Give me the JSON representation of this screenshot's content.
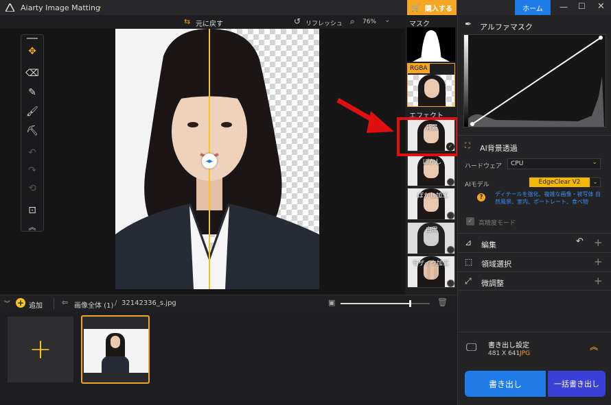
{
  "app": {
    "title": "Aiarty Image Matting",
    "buy_label": "購入する",
    "home_label": "ホーム"
  },
  "toolbar": {
    "undo_all_label": "元に戻す",
    "refresh_label": "リフレッシュ",
    "zoom": "76%"
  },
  "effects": {
    "mask_header": "マスク",
    "rgba_label": "RGBA",
    "effect_header": "エフェクト",
    "items": [
      "背景",
      "ぼかし",
      "ぼかし加工",
      "白黒",
      "モザイク加工"
    ]
  },
  "files": {
    "add_label": "追加",
    "breadcrumb_root": "画像全体 (1)",
    "separator": "/",
    "filename": "32142336_s.jpg"
  },
  "panel": {
    "alpha_mask_title": "アルファマスク",
    "ai_bg_title": "AI背景透過",
    "hardware_label": "ハードウェア",
    "hardware_value": "CPU",
    "ai_model_label": "AIモデル",
    "ai_model_value": "EdgeClear  V2",
    "model_desc": "ディテールを強化、複雑な画像・被写体 自然風景、室内、ポートレート、食べ物",
    "hq_mode_label": "高精度モード",
    "edit_label": "編集",
    "region_label": "領域選択",
    "fine_label": "微調整",
    "export_settings_title": "書き出し設定",
    "export_size": "481 X 641",
    "export_format": "JPG",
    "export_btn": "書き出し",
    "batch_export_btn": "一括書き出し"
  },
  "colors": {
    "accent": "#f5a623",
    "brand_blue": "#1e7be8",
    "highlight_red": "#e01010",
    "model_yellow": "#f5b800"
  }
}
